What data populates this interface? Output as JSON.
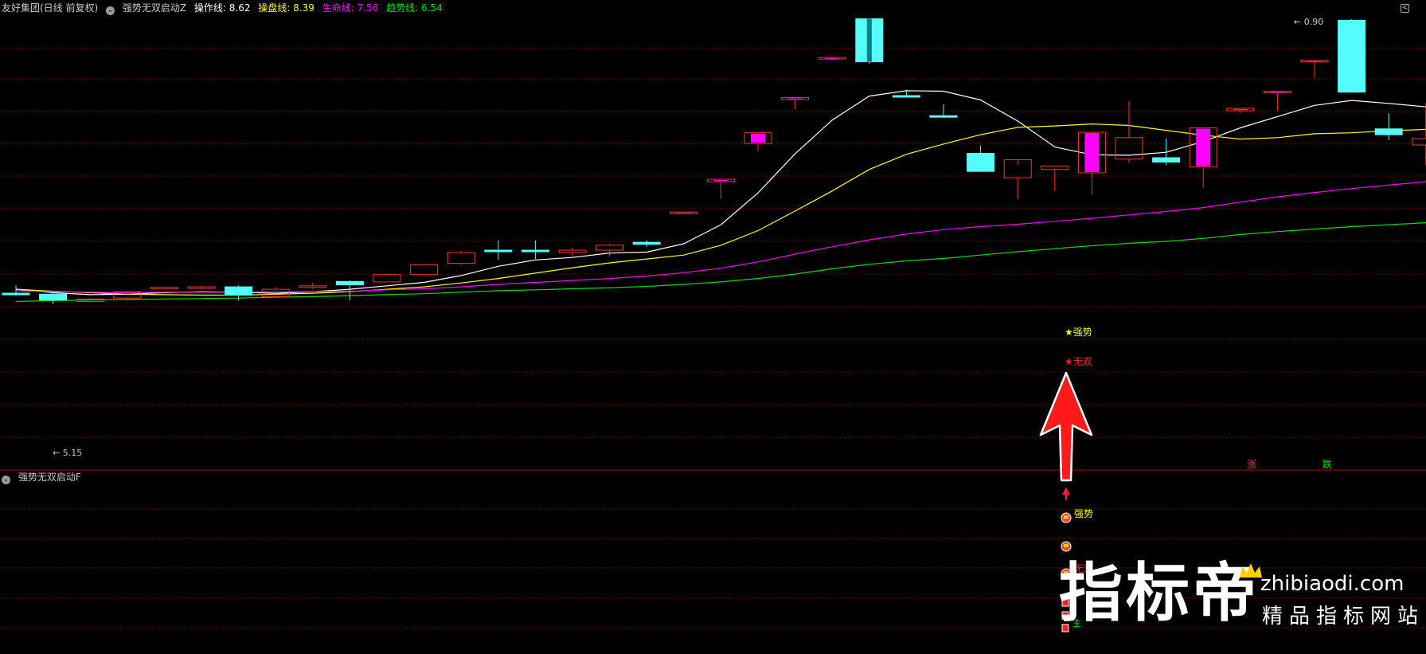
{
  "header": {
    "stock_name": "友好集团(日线 前复权)",
    "main_indicator": "强势无双启动Z",
    "lines": [
      {
        "label": "操作线:",
        "value": "8.62",
        "color": "#ffffff"
      },
      {
        "label": "操盘线:",
        "value": "8.39",
        "color": "#ffff00"
      },
      {
        "label": "生命线:",
        "value": "7.56",
        "color": "#ff00ff"
      },
      {
        "label": "趋势线:",
        "value": "6.54",
        "color": "#00e000"
      }
    ],
    "collapse_glyph": "<"
  },
  "sub_panel": {
    "indicator": "强势无双启动F"
  },
  "annotations": {
    "high_label": "0.90",
    "low_label": "5.15",
    "qiangshi": "★强势",
    "wushuang": "★无双",
    "zhang": "涨",
    "die": "跌",
    "sub_qiangshi": "强势",
    "sub_wushuang": "无双",
    "sub_zhu": "主"
  },
  "watermark": {
    "brand": "指标帝",
    "domain": "zhibiaodi.com",
    "slogan": "精品指标网站"
  },
  "colors": {
    "up": "#ff3030",
    "down": "#54fcfc",
    "hot": "#ff00ff",
    "grid": "#8b0000"
  },
  "chart_data": {
    "type": "candlestick",
    "candles": [
      {
        "o": 5.32,
        "h": 5.48,
        "l": 5.27,
        "c": 5.3,
        "t": "down"
      },
      {
        "o": 5.3,
        "h": 5.32,
        "l": 5.1,
        "c": 5.18,
        "t": "down"
      },
      {
        "o": 5.15,
        "h": 5.22,
        "l": 5.14,
        "c": 5.2,
        "t": "up"
      },
      {
        "o": 5.22,
        "h": 5.37,
        "l": 5.2,
        "c": 5.35,
        "t": "up"
      },
      {
        "o": 5.44,
        "h": 5.45,
        "l": 5.4,
        "c": 5.42,
        "t": "up"
      },
      {
        "o": 5.45,
        "h": 5.48,
        "l": 5.4,
        "c": 5.43,
        "t": "up"
      },
      {
        "o": 5.45,
        "h": 5.48,
        "l": 5.17,
        "c": 5.28,
        "t": "down"
      },
      {
        "o": 5.25,
        "h": 5.44,
        "l": 5.22,
        "c": 5.4,
        "t": "up"
      },
      {
        "o": 5.47,
        "h": 5.53,
        "l": 5.4,
        "c": 5.45,
        "t": "up"
      },
      {
        "o": 5.56,
        "h": 5.58,
        "l": 5.17,
        "c": 5.49,
        "t": "down"
      },
      {
        "o": 5.55,
        "h": 5.71,
        "l": 5.54,
        "c": 5.7,
        "t": "up"
      },
      {
        "o": 5.7,
        "h": 5.92,
        "l": 5.68,
        "c": 5.9,
        "t": "up"
      },
      {
        "o": 5.93,
        "h": 6.18,
        "l": 5.9,
        "c": 6.15,
        "t": "up"
      },
      {
        "o": 6.2,
        "h": 6.4,
        "l": 6.0,
        "c": 6.2,
        "t": "down"
      },
      {
        "o": 6.2,
        "h": 6.4,
        "l": 6.02,
        "c": 6.2,
        "t": "down"
      },
      {
        "o": 6.15,
        "h": 6.25,
        "l": 6.05,
        "c": 6.2,
        "t": "up"
      },
      {
        "o": 6.2,
        "h": 6.33,
        "l": 6.07,
        "c": 6.3,
        "t": "up"
      },
      {
        "o": 6.36,
        "h": 6.4,
        "l": 6.27,
        "c": 6.32,
        "t": "down"
      },
      {
        "o": 6.98,
        "h": 6.99,
        "l": 6.97,
        "c": 6.98,
        "t": "hot"
      },
      {
        "o": 7.6,
        "h": 7.65,
        "l": 7.25,
        "c": 7.65,
        "t": "hot"
      },
      {
        "o": 8.38,
        "h": 8.6,
        "l": 8.22,
        "c": 8.6,
        "t": "hot"
      },
      {
        "o": 9.28,
        "h": 9.32,
        "l": 9.08,
        "c": 9.32,
        "t": "hot"
      },
      {
        "o": 10.14,
        "h": 10.15,
        "l": 10.13,
        "c": 10.14,
        "t": "hot"
      },
      {
        "o": 10.93,
        "h": 10.93,
        "l": 10.01,
        "c": 10.05,
        "t": "down"
      },
      {
        "o": 9.35,
        "h": 9.48,
        "l": 9.32,
        "c": 9.36,
        "t": "down"
      },
      {
        "o": 8.95,
        "h": 9.18,
        "l": 8.95,
        "c": 8.95,
        "t": "down"
      },
      {
        "o": 8.18,
        "h": 8.34,
        "l": 7.84,
        "c": 7.81,
        "t": "down"
      },
      {
        "o": 7.68,
        "h": 7.95,
        "l": 7.24,
        "c": 8.05,
        "t": "up"
      },
      {
        "o": 7.85,
        "h": 7.92,
        "l": 7.4,
        "c": 7.92,
        "t": "up"
      },
      {
        "o": 7.78,
        "h": 8.35,
        "l": 7.33,
        "c": 8.61,
        "t": "hot"
      },
      {
        "o": 8.06,
        "h": 9.25,
        "l": 7.98,
        "c": 8.5,
        "t": "up"
      },
      {
        "o": 8.0,
        "h": 8.48,
        "l": 7.94,
        "c": 8.09,
        "t": "down"
      },
      {
        "o": 7.9,
        "h": 8.65,
        "l": 7.48,
        "c": 8.7,
        "t": "hot"
      },
      {
        "o": 9.05,
        "h": 9.1,
        "l": 9.0,
        "c": 9.1,
        "t": "hot"
      },
      {
        "o": 9.45,
        "h": 9.45,
        "l": 9.04,
        "c": 9.45,
        "t": "hot"
      },
      {
        "o": 10.08,
        "h": 10.08,
        "l": 9.72,
        "c": 10.08,
        "t": "hot"
      },
      {
        "o": 10.9,
        "h": 10.92,
        "l": 9.43,
        "c": 9.43,
        "t": "down"
      },
      {
        "o": 8.68,
        "h": 9.0,
        "l": 8.45,
        "c": 8.56,
        "t": "down"
      },
      {
        "o": 8.35,
        "h": 9.2,
        "l": 7.94,
        "c": 8.48,
        "t": "up"
      },
      {
        "o": 8.05,
        "h": 8.75,
        "l": 8.03,
        "c": 8.55,
        "t": "up"
      }
    ],
    "series": [
      {
        "name": "操作线",
        "color": "#ffffff",
        "values": [
          5.4,
          5.33,
          5.29,
          5.3,
          5.33,
          5.35,
          5.34,
          5.32,
          5.35,
          5.4,
          5.47,
          5.54,
          5.68,
          5.87,
          6.0,
          6.05,
          6.14,
          6.16,
          6.33,
          6.72,
          7.37,
          8.17,
          8.86,
          9.35,
          9.46,
          9.45,
          9.27,
          8.84,
          8.31,
          8.15,
          8.14,
          8.2,
          8.42,
          8.7,
          8.93,
          9.16,
          9.26,
          9.2,
          9.13,
          8.97
        ]
      },
      {
        "name": "操盘线",
        "color": "#ffff00",
        "values": [
          5.4,
          5.36,
          5.33,
          5.3,
          5.29,
          5.28,
          5.28,
          5.3,
          5.32,
          5.35,
          5.4,
          5.45,
          5.53,
          5.62,
          5.73,
          5.84,
          5.94,
          6.02,
          6.1,
          6.3,
          6.6,
          7.0,
          7.41,
          7.85,
          8.16,
          8.37,
          8.56,
          8.71,
          8.74,
          8.78,
          8.75,
          8.65,
          8.55,
          8.47,
          8.5,
          8.58,
          8.6,
          8.64,
          8.67,
          8.7
        ]
      },
      {
        "name": "生命线",
        "color": "#ff00ff",
        "values": [
          5.37,
          5.35,
          5.34,
          5.33,
          5.34,
          5.34,
          5.34,
          5.35,
          5.35,
          5.36,
          5.39,
          5.41,
          5.45,
          5.5,
          5.54,
          5.58,
          5.62,
          5.67,
          5.74,
          5.83,
          5.96,
          6.12,
          6.27,
          6.41,
          6.53,
          6.62,
          6.68,
          6.73,
          6.79,
          6.85,
          6.92,
          6.99,
          7.07,
          7.18,
          7.29,
          7.38,
          7.46,
          7.53,
          7.6,
          7.66
        ]
      },
      {
        "name": "趋势线",
        "color": "#00e000",
        "values": [
          5.15,
          5.17,
          5.18,
          5.19,
          5.2,
          5.21,
          5.22,
          5.24,
          5.25,
          5.27,
          5.29,
          5.31,
          5.34,
          5.37,
          5.39,
          5.41,
          5.43,
          5.46,
          5.5,
          5.55,
          5.62,
          5.71,
          5.82,
          5.91,
          5.98,
          6.03,
          6.1,
          6.17,
          6.23,
          6.29,
          6.34,
          6.38,
          6.44,
          6.52,
          6.58,
          6.63,
          6.68,
          6.72,
          6.76,
          6.8
        ]
      }
    ]
  }
}
